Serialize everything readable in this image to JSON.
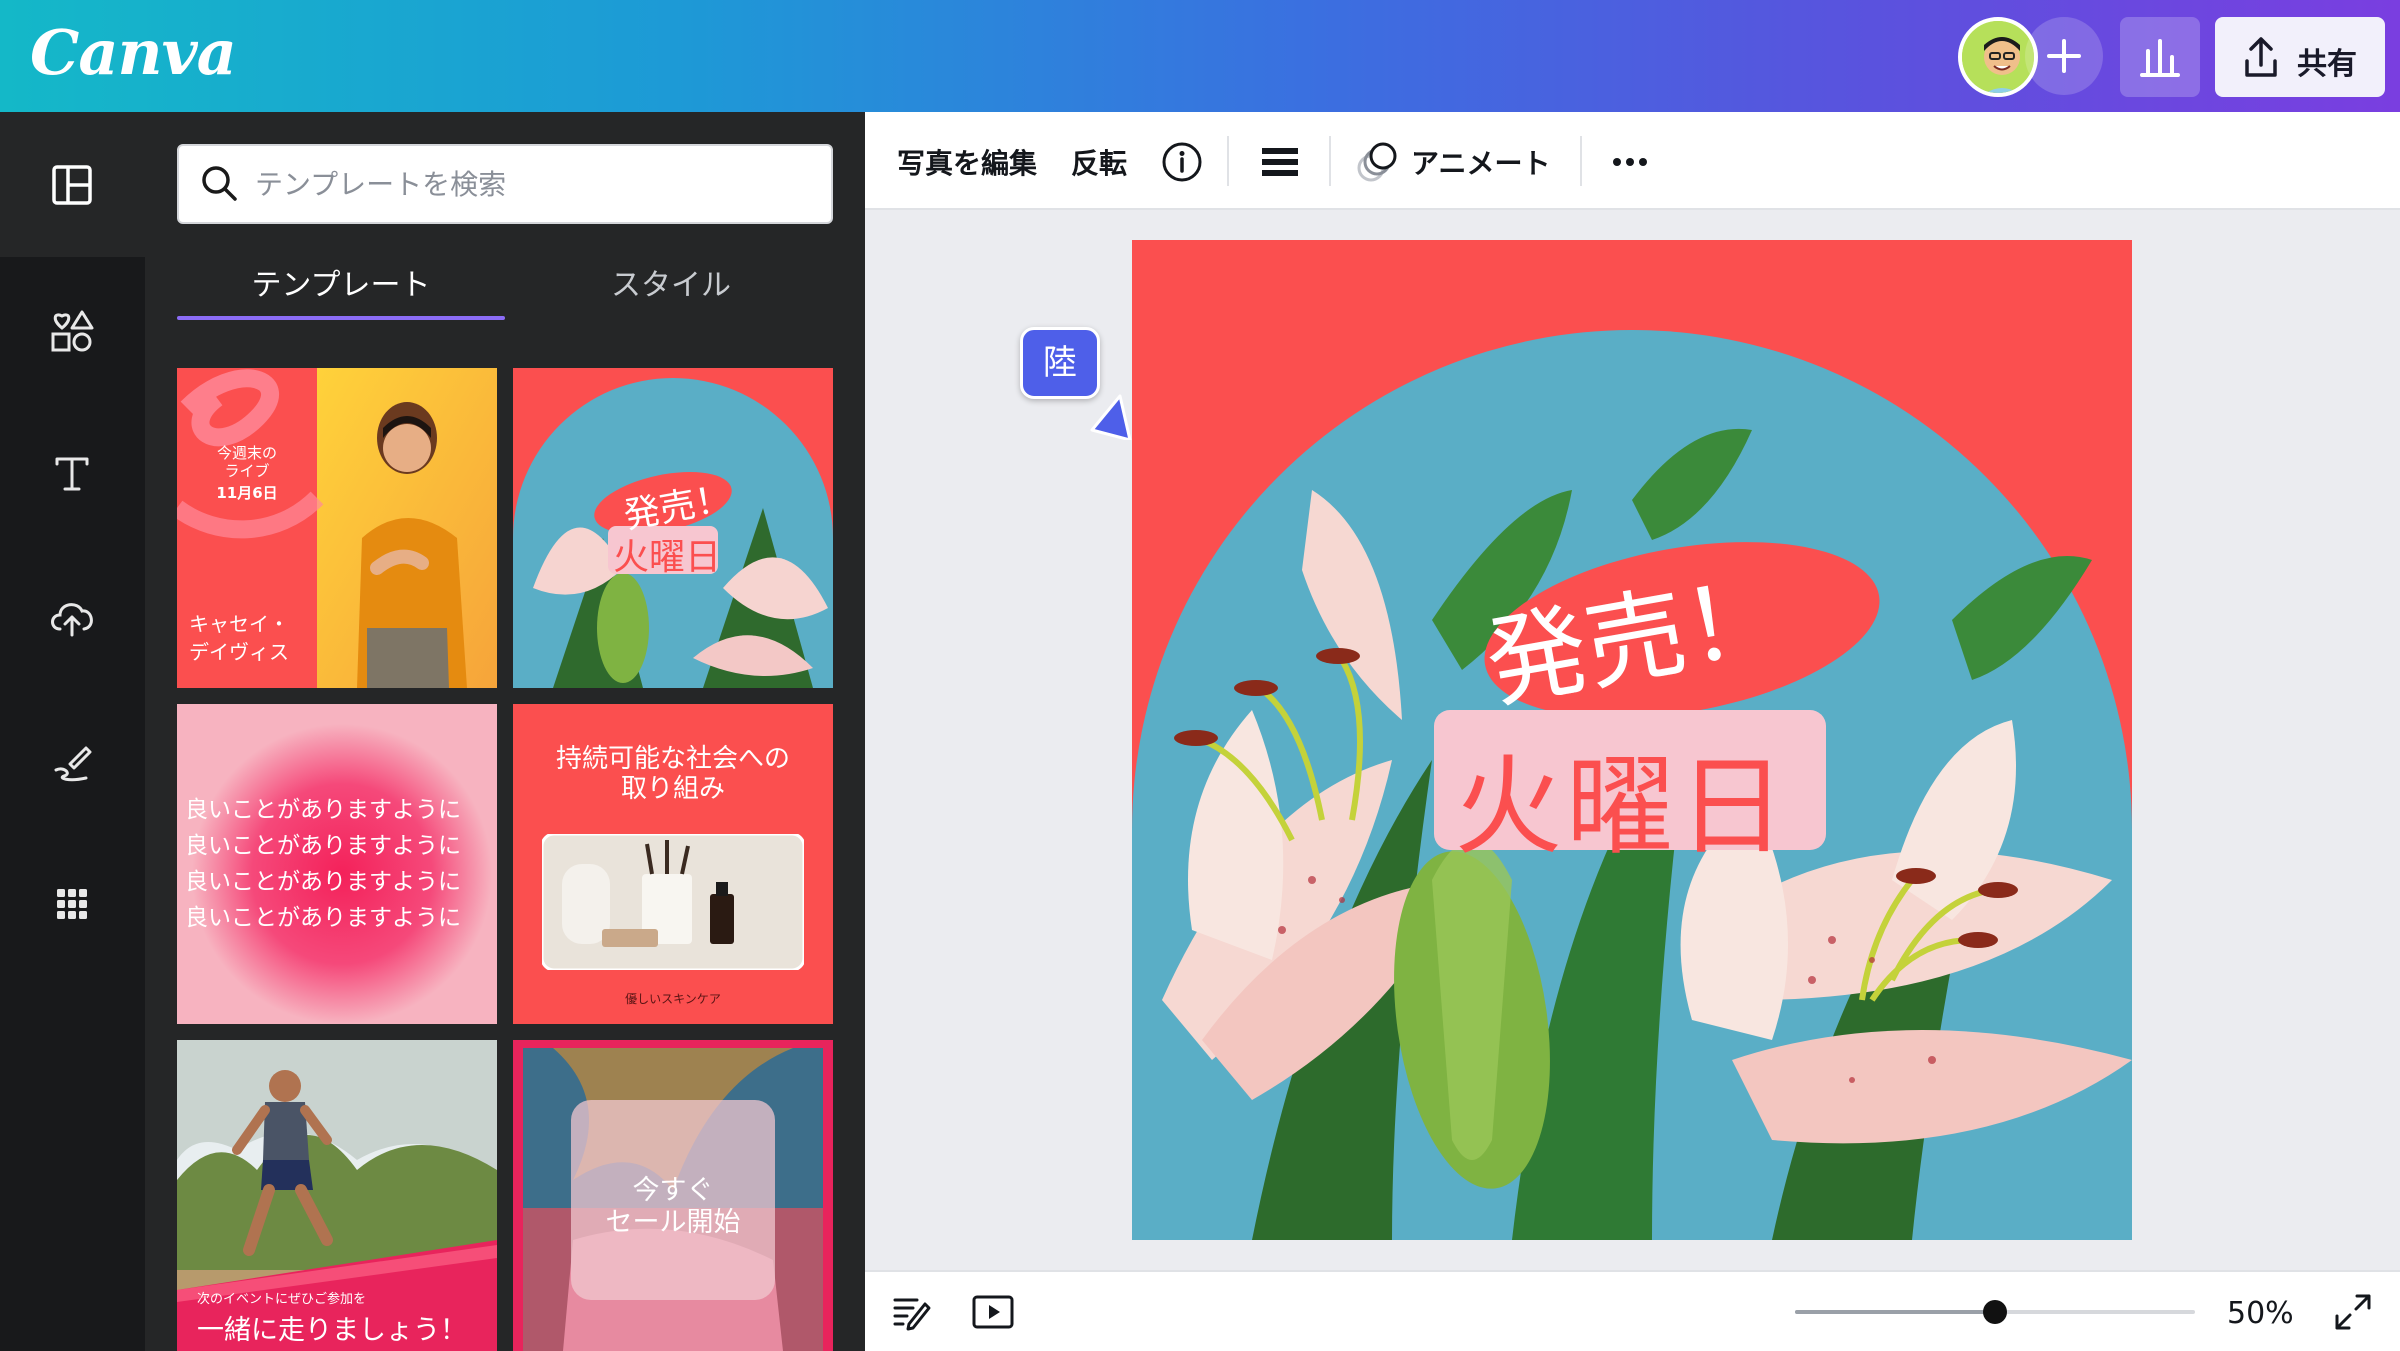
{
  "app": {
    "logo": "Canva"
  },
  "header": {
    "share_label": "共有",
    "add_collaborator": "+",
    "insights": "Insights"
  },
  "search": {
    "placeholder": "テンプレートを検索"
  },
  "tabs": [
    {
      "label": "テンプレート",
      "active": true
    },
    {
      "label": "スタイル",
      "active": false
    }
  ],
  "templates": {
    "t1": {
      "top": "今週末の",
      "mid": "ライブ",
      "date": "11月6日",
      "name1": "キャセイ・",
      "name2": "デイヴィス"
    },
    "t2": {
      "line1": "発売！",
      "line2": "火曜日"
    },
    "t3": {
      "lines": [
        "良いことがありますように",
        "良いことがありますように",
        "良いことがありますように",
        "良いことがありますように"
      ]
    },
    "t4": {
      "title1": "持続可能な社会への",
      "title2": "取り組み",
      "caption": "優しいスキンケア"
    },
    "t5": {
      "small": "次のイベントにぜひご参加を",
      "big": "一緒に走りましょう！"
    },
    "t6": {
      "line1": "今すぐ",
      "line2": "セール開始"
    }
  },
  "toolbar": {
    "edit_photo": "写真を編集",
    "flip": "反転",
    "animate": "アニメート"
  },
  "canvas": {
    "headline1": "発売！",
    "headline2": "火曜日",
    "collaborator": "陸"
  },
  "zoom": {
    "label": "50%",
    "value": 0.5
  },
  "colors": {
    "brand_gradient_start": "#14b8c8",
    "brand_gradient_end": "#7a3ee0",
    "artboard_red": "#fb4f4f",
    "sky_blue": "#5aaec6",
    "pink_tag": "#f7c6d0",
    "collab_purple": "#4e5fe9",
    "tab_underline": "#8b6cf6"
  },
  "icons": {
    "rail": [
      "layout-icon",
      "elements-icon",
      "text-icon",
      "upload-icon",
      "draw-icon",
      "apps-icon"
    ],
    "toolbar": [
      "info-icon",
      "position-icon",
      "animate-icon",
      "more-icon"
    ],
    "bottom": [
      "notes-icon",
      "present-icon",
      "fullscreen-icon"
    ],
    "header": [
      "avatar",
      "add-icon",
      "insights-icon",
      "upload-share-icon"
    ]
  }
}
